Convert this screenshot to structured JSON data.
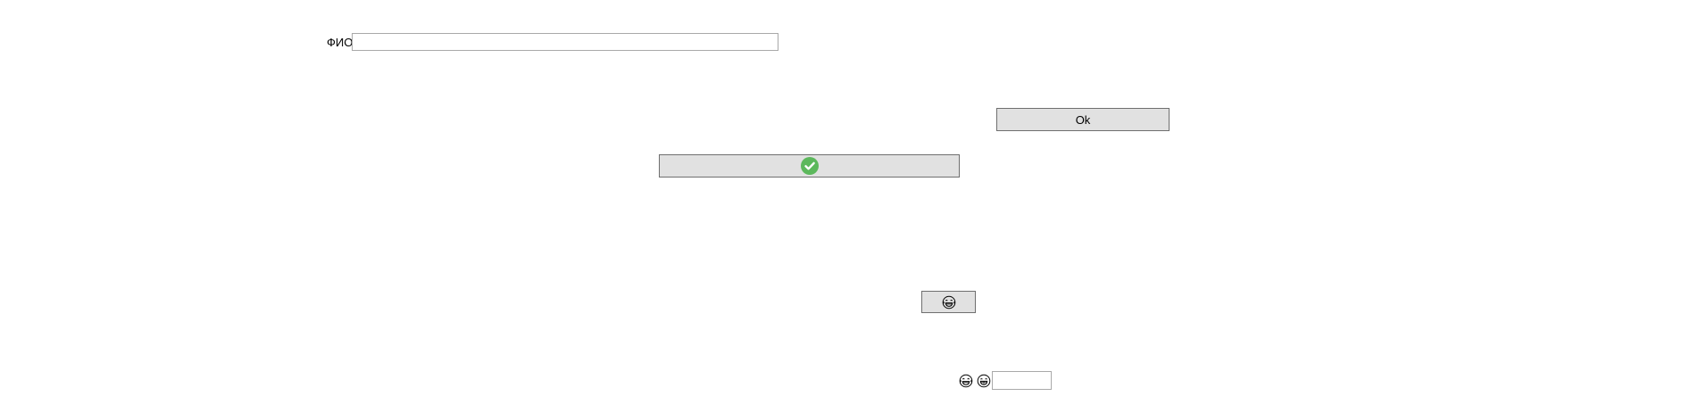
{
  "form": {
    "fio_label": "ФИО",
    "fio_value": "",
    "fio_placeholder": ""
  },
  "buttons": {
    "ok_label": "Ok",
    "check_icon": "check-circle-icon",
    "emoji_icon": "laughing-face-icon"
  },
  "bottom_row": {
    "icons": [
      "laughing-face-icon",
      "grinning-face-icon"
    ],
    "input_value": ""
  },
  "colors": {
    "check_green": "#5cb85c",
    "button_bg": "#e1e1e1"
  }
}
